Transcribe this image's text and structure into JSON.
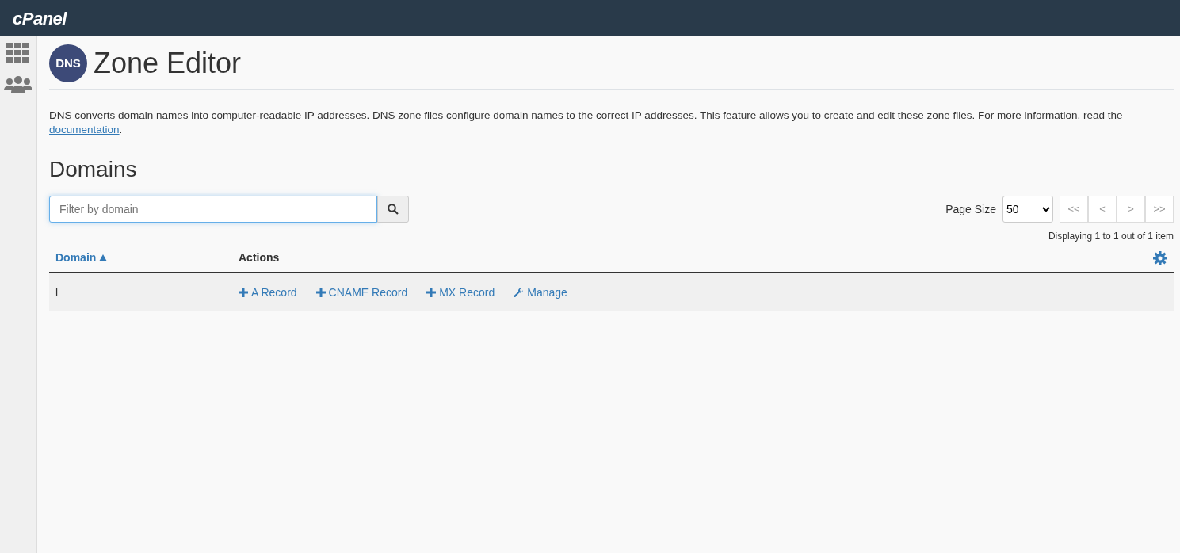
{
  "header": {
    "logo": "cPanel"
  },
  "sidebar": {
    "items": [
      {
        "kind": "grid"
      },
      {
        "kind": "users"
      }
    ]
  },
  "page": {
    "title": "Zone Editor",
    "icon_text": "DNS",
    "description_before": "DNS converts domain names into computer-readable IP addresses. DNS zone files configure domain names to the correct IP addresses. This feature allows you to create and edit these zone files. For more information, read the ",
    "description_link": "documentation",
    "description_after": "."
  },
  "section": {
    "title": "Domains"
  },
  "search": {
    "placeholder": "Filter by domain"
  },
  "pagination": {
    "label": "Page Size",
    "page_size": "50",
    "buttons": [
      {
        "label": "<<",
        "disabled": true
      },
      {
        "label": "<",
        "disabled": true
      },
      {
        "label": ">",
        "disabled": true
      },
      {
        "label": ">>",
        "disabled": true
      }
    ],
    "summary": "Displaying 1 to 1 out of 1 item"
  },
  "table": {
    "columns": [
      {
        "label": "Domain",
        "sorted": true
      },
      {
        "label": "Actions",
        "sorted": false
      }
    ],
    "rows": [
      {
        "domain": "l",
        "actions": [
          {
            "kind": "add",
            "label": "A Record"
          },
          {
            "kind": "add",
            "label": "CNAME Record"
          },
          {
            "kind": "add",
            "label": "MX Record"
          },
          {
            "kind": "manage",
            "label": "Manage"
          }
        ]
      }
    ]
  }
}
